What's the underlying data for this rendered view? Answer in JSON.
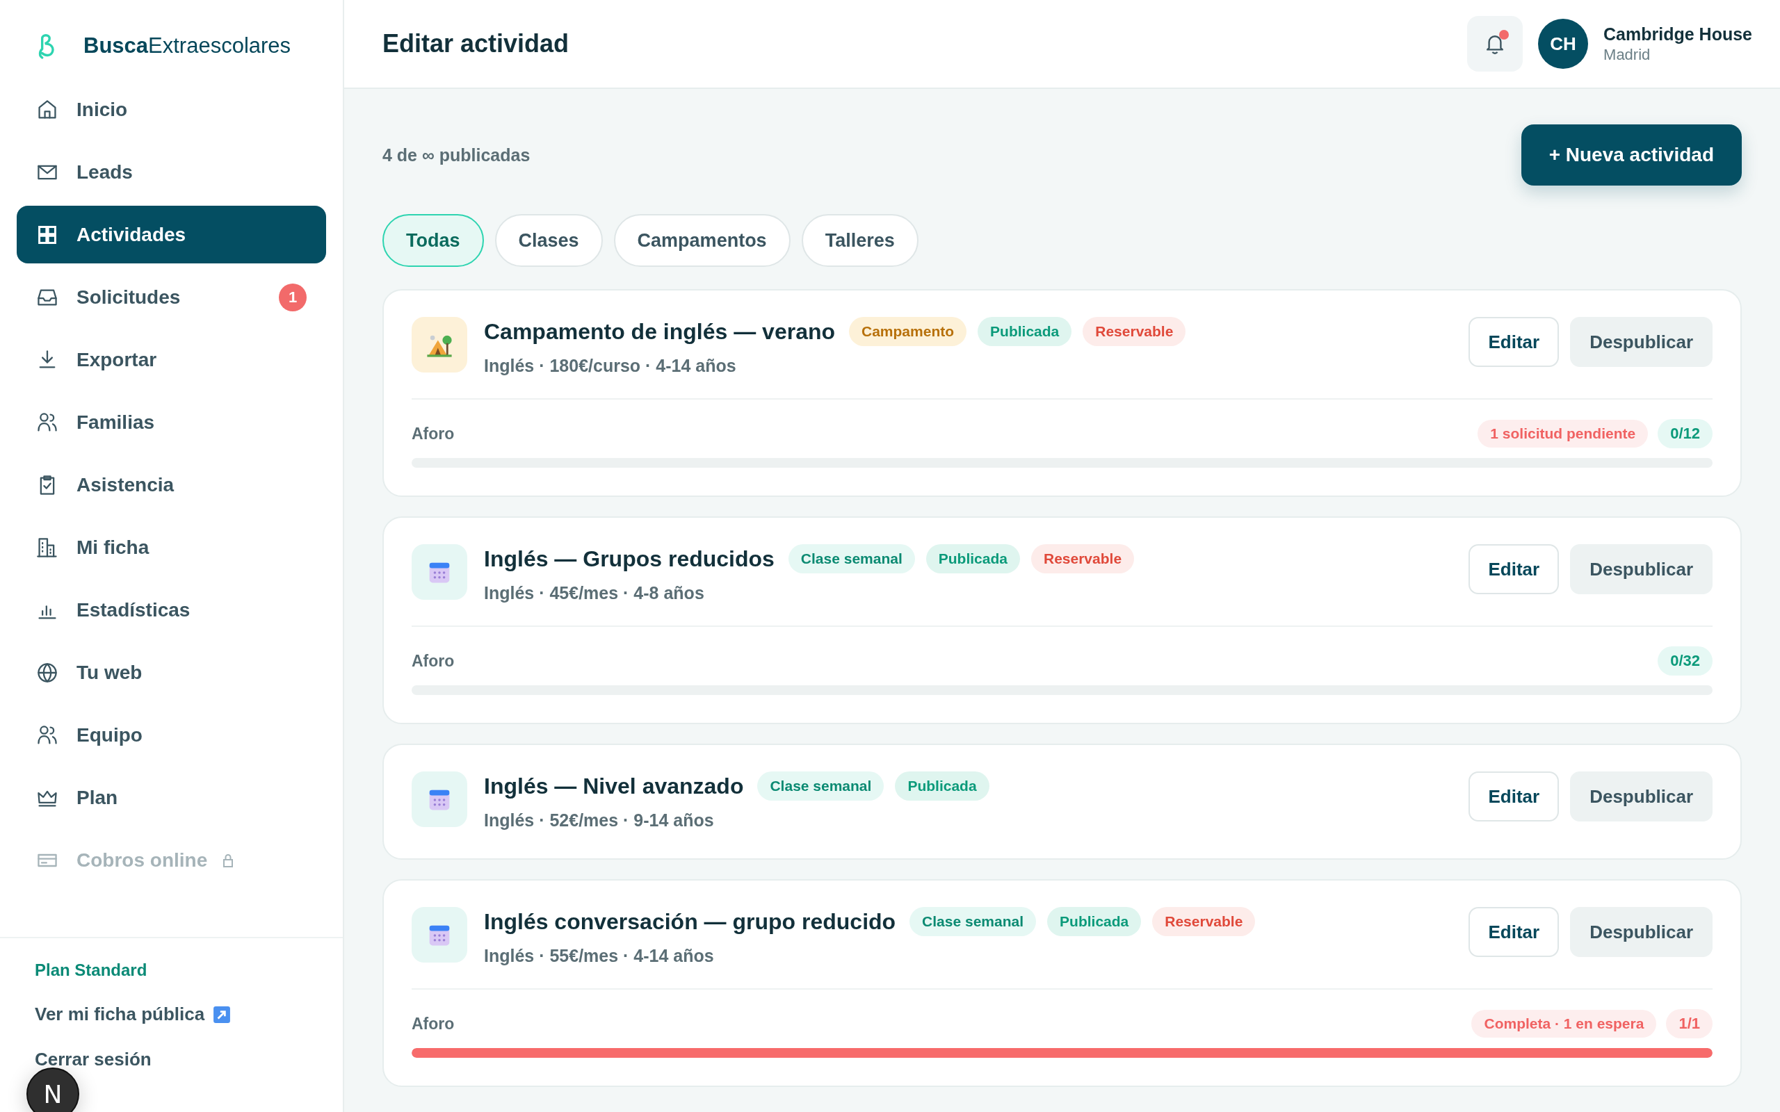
{
  "brand": {
    "bold": "Busca",
    "rest": "Extraescolares"
  },
  "sidebar": {
    "items": [
      {
        "kind": "home",
        "label": "Inicio",
        "selected": false,
        "disabled": false
      },
      {
        "kind": "mail",
        "label": "Leads",
        "selected": false,
        "disabled": false
      },
      {
        "kind": "grid",
        "label": "Actividades",
        "selected": true,
        "disabled": false
      },
      {
        "kind": "inbox",
        "label": "Solicitudes",
        "selected": false,
        "disabled": false,
        "badge": "1"
      },
      {
        "kind": "download",
        "label": "Exportar",
        "selected": false,
        "disabled": false
      },
      {
        "kind": "users",
        "label": "Familias",
        "selected": false,
        "disabled": false
      },
      {
        "kind": "clipboard",
        "label": "Asistencia",
        "selected": false,
        "disabled": false
      },
      {
        "kind": "building",
        "label": "Mi ficha",
        "selected": false,
        "disabled": false
      },
      {
        "kind": "chart",
        "label": "Estadísticas",
        "selected": false,
        "disabled": false
      },
      {
        "kind": "globe",
        "label": "Tu web",
        "selected": false,
        "disabled": false
      },
      {
        "kind": "users",
        "label": "Equipo",
        "selected": false,
        "disabled": false
      },
      {
        "kind": "crown",
        "label": "Plan",
        "selected": false,
        "disabled": false
      },
      {
        "kind": "card",
        "label": "Cobros online",
        "selected": false,
        "disabled": true
      }
    ],
    "plan": "Plan Standard",
    "public_link": "Ver mi ficha pública",
    "logout": "Cerrar sesión"
  },
  "dev_badge": "N",
  "header": {
    "title": "Editar actividad",
    "notifications_unread": true,
    "avatar": "CH",
    "org": "Cambridge House",
    "city": "Madrid"
  },
  "summary": "4 de ∞ publicadas",
  "new_button": "+ Nueva actividad",
  "tabs": [
    {
      "label": "Todas",
      "selected": true
    },
    {
      "label": "Clases",
      "selected": false
    },
    {
      "label": "Campamentos",
      "selected": false
    },
    {
      "label": "Talleres",
      "selected": false
    }
  ],
  "activities": [
    {
      "kind": "tent",
      "title": "Campamento de inglés — verano",
      "tags": [
        {
          "kind": "campamento",
          "label": "Campamento"
        },
        {
          "kind": "publicada",
          "label": "Publicada"
        },
        {
          "kind": "reservable",
          "label": "Reservable"
        }
      ],
      "meta": "Inglés · 180€/curso · 4-14 años",
      "actions": [
        "Editar",
        "Despublicar"
      ],
      "capacity": {
        "label": "Aforo",
        "notice": "1 solicitud pendiente",
        "count": "0/12",
        "full": false,
        "level": 0
      }
    },
    {
      "kind": "calendar",
      "title": "Inglés — Grupos reducidos",
      "tags": [
        {
          "kind": "clase",
          "label": "Clase semanal"
        },
        {
          "kind": "publicada",
          "label": "Publicada"
        },
        {
          "kind": "reservable",
          "label": "Reservable"
        }
      ],
      "meta": "Inglés · 45€/mes · 4-8 años",
      "actions": [
        "Editar",
        "Despublicar"
      ],
      "capacity": {
        "label": "Aforo",
        "count": "0/32",
        "full": false,
        "level": 0
      }
    },
    {
      "kind": "calendar",
      "title": "Inglés — Nivel avanzado",
      "tags": [
        {
          "kind": "clase",
          "label": "Clase semanal"
        },
        {
          "kind": "publicada",
          "label": "Publicada"
        }
      ],
      "meta": "Inglés · 52€/mes · 9-14 años",
      "actions": [
        "Editar",
        "Despublicar"
      ]
    },
    {
      "kind": "calendar",
      "title": "Inglés conversación — grupo reducido",
      "tags": [
        {
          "kind": "clase",
          "label": "Clase semanal"
        },
        {
          "kind": "publicada",
          "label": "Publicada"
        },
        {
          "kind": "reservable",
          "label": "Reservable"
        }
      ],
      "meta": "Inglés · 55€/mes · 4-14 años",
      "actions": [
        "Editar",
        "Despublicar"
      ],
      "capacity": {
        "label": "Aforo",
        "notice": "Completa · 1 en espera",
        "count": "1/1",
        "full": true,
        "level": 1
      }
    }
  ]
}
